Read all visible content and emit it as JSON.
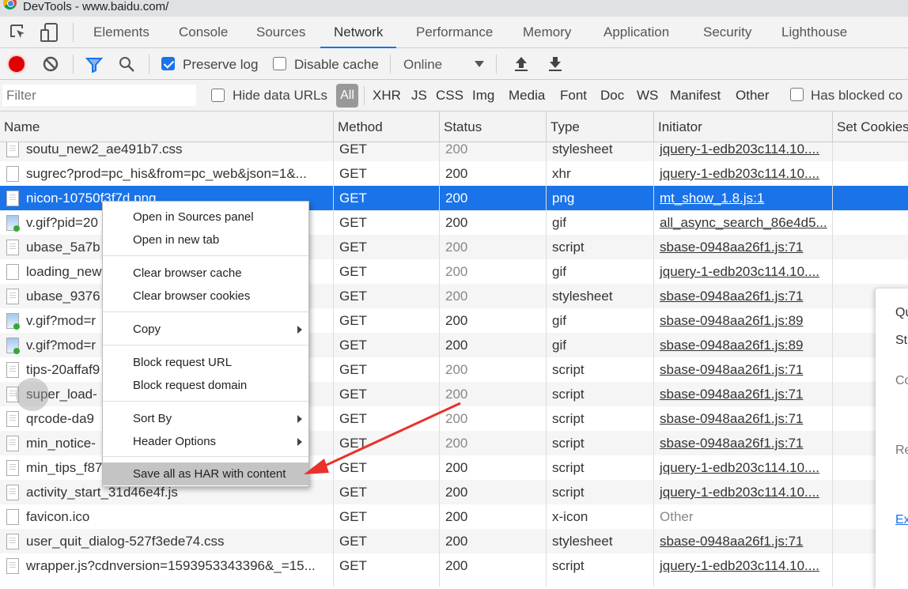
{
  "window": {
    "title": "DevTools - www.baidu.com/"
  },
  "tabs": [
    {
      "label": "Elements"
    },
    {
      "label": "Console"
    },
    {
      "label": "Sources"
    },
    {
      "label": "Network",
      "active": true
    },
    {
      "label": "Performance"
    },
    {
      "label": "Memory"
    },
    {
      "label": "Application"
    },
    {
      "label": "Security"
    },
    {
      "label": "Lighthouse"
    }
  ],
  "toolbar": {
    "preserve_log": "Preserve log",
    "preserve_log_checked": true,
    "disable_cache": "Disable cache",
    "disable_cache_checked": false,
    "throttling": "Online",
    "record_color": "#e00000"
  },
  "filterbar": {
    "placeholder": "Filter",
    "hide_data_urls": "Hide data URLs",
    "types": [
      "All",
      "XHR",
      "JS",
      "CSS",
      "Img",
      "Media",
      "Font",
      "Doc",
      "WS",
      "Manifest",
      "Other"
    ],
    "has_blocked": "Has blocked co"
  },
  "columns": [
    "Name",
    "Method",
    "Status",
    "Type",
    "Initiator",
    "Set Cookies"
  ],
  "rows": [
    {
      "name": "soutu_new2_ae491b7.css",
      "icon": "doc",
      "method": "GET",
      "status": "200",
      "status_gray": true,
      "type": "stylesheet",
      "initiator": "jquery-1-edb203c114.10...."
    },
    {
      "name": "sugrec?prod=pc_his&from=pc_web&json=1&...",
      "icon": "blank",
      "method": "GET",
      "status": "200",
      "type": "xhr",
      "initiator": "jquery-1-edb203c114.10...."
    },
    {
      "name": "nicon-10750f3f7d.png",
      "icon": "doc",
      "method": "GET",
      "status": "200",
      "type": "png",
      "initiator": "mt_show_1.8.js:1",
      "selected": true
    },
    {
      "name": "v.gif?pid=20",
      "icon": "img",
      "method": "GET",
      "status": "200",
      "type": "gif",
      "initiator": "all_async_search_86e4d5..."
    },
    {
      "name": "ubase_5a7b",
      "icon": "doc",
      "method": "GET",
      "status": "200",
      "status_gray": true,
      "type": "script",
      "initiator": "sbase-0948aa26f1.js:71"
    },
    {
      "name": "loading_new",
      "icon": "blank",
      "method": "GET",
      "status": "200",
      "status_gray": true,
      "type": "gif",
      "initiator": "jquery-1-edb203c114.10...."
    },
    {
      "name": "ubase_9376",
      "icon": "doc",
      "method": "GET",
      "status": "200",
      "status_gray": true,
      "type": "stylesheet",
      "initiator": "sbase-0948aa26f1.js:71"
    },
    {
      "name": "v.gif?mod=r",
      "icon": "img",
      "method": "GET",
      "status": "200",
      "type": "gif",
      "initiator": "sbase-0948aa26f1.js:89"
    },
    {
      "name": "v.gif?mod=r",
      "icon": "img",
      "method": "GET",
      "status": "200",
      "type": "gif",
      "initiator": "sbase-0948aa26f1.js:89"
    },
    {
      "name": "tips-20affaf9",
      "icon": "doc",
      "method": "GET",
      "status": "200",
      "status_gray": true,
      "type": "script",
      "initiator": "sbase-0948aa26f1.js:71"
    },
    {
      "name": "super_load-",
      "icon": "doc",
      "method": "GET",
      "status": "200",
      "status_gray": true,
      "type": "script",
      "initiator": "sbase-0948aa26f1.js:71"
    },
    {
      "name": "qrcode-da9",
      "icon": "doc",
      "method": "GET",
      "status": "200",
      "status_gray": true,
      "type": "script",
      "initiator": "sbase-0948aa26f1.js:71"
    },
    {
      "name": "min_notice-",
      "icon": "doc",
      "method": "GET",
      "status": "200",
      "status_gray": true,
      "type": "script",
      "initiator": "sbase-0948aa26f1.js:71"
    },
    {
      "name": "min_tips_f87",
      "icon": "doc",
      "method": "GET",
      "status": "200",
      "type": "script",
      "initiator": "jquery-1-edb203c114.10...."
    },
    {
      "name": "activity_start_31d46e4f.js",
      "icon": "doc",
      "method": "GET",
      "status": "200",
      "type": "script",
      "initiator": "jquery-1-edb203c114.10...."
    },
    {
      "name": "favicon.ico",
      "icon": "blank",
      "method": "GET",
      "status": "200",
      "type": "x-icon",
      "initiator": "Other",
      "initiator_plain": true
    },
    {
      "name": "user_quit_dialog-527f3ede74.css",
      "icon": "doc",
      "method": "GET",
      "status": "200",
      "type": "stylesheet",
      "initiator": "sbase-0948aa26f1.js:71"
    },
    {
      "name": "wrapper.js?cdnversion=1593953343396&_=15...",
      "icon": "doc",
      "method": "GET",
      "status": "200",
      "type": "script",
      "initiator": "jquery-1-edb203c114.10...."
    }
  ],
  "context_menu": {
    "groups": [
      [
        {
          "label": "Open in Sources panel"
        },
        {
          "label": "Open in new tab"
        }
      ],
      [
        {
          "label": "Clear browser cache"
        },
        {
          "label": "Clear browser cookies"
        }
      ],
      [
        {
          "label": "Copy",
          "submenu": true
        }
      ],
      [
        {
          "label": "Block request URL"
        },
        {
          "label": "Block request domain"
        }
      ],
      [
        {
          "label": "Sort By",
          "submenu": true
        },
        {
          "label": "Header Options",
          "submenu": true
        }
      ],
      [
        {
          "label": "Save all as HAR with content",
          "highlighted": true
        }
      ]
    ]
  },
  "side_panel": {
    "lines": [
      "Qu",
      "St",
      "Co",
      "Re",
      "Ex"
    ]
  },
  "annotation": {
    "arrow_color": "#e8322c"
  },
  "colors": {
    "accent": "#1a73e8",
    "selected_row": "#1a73e8"
  }
}
